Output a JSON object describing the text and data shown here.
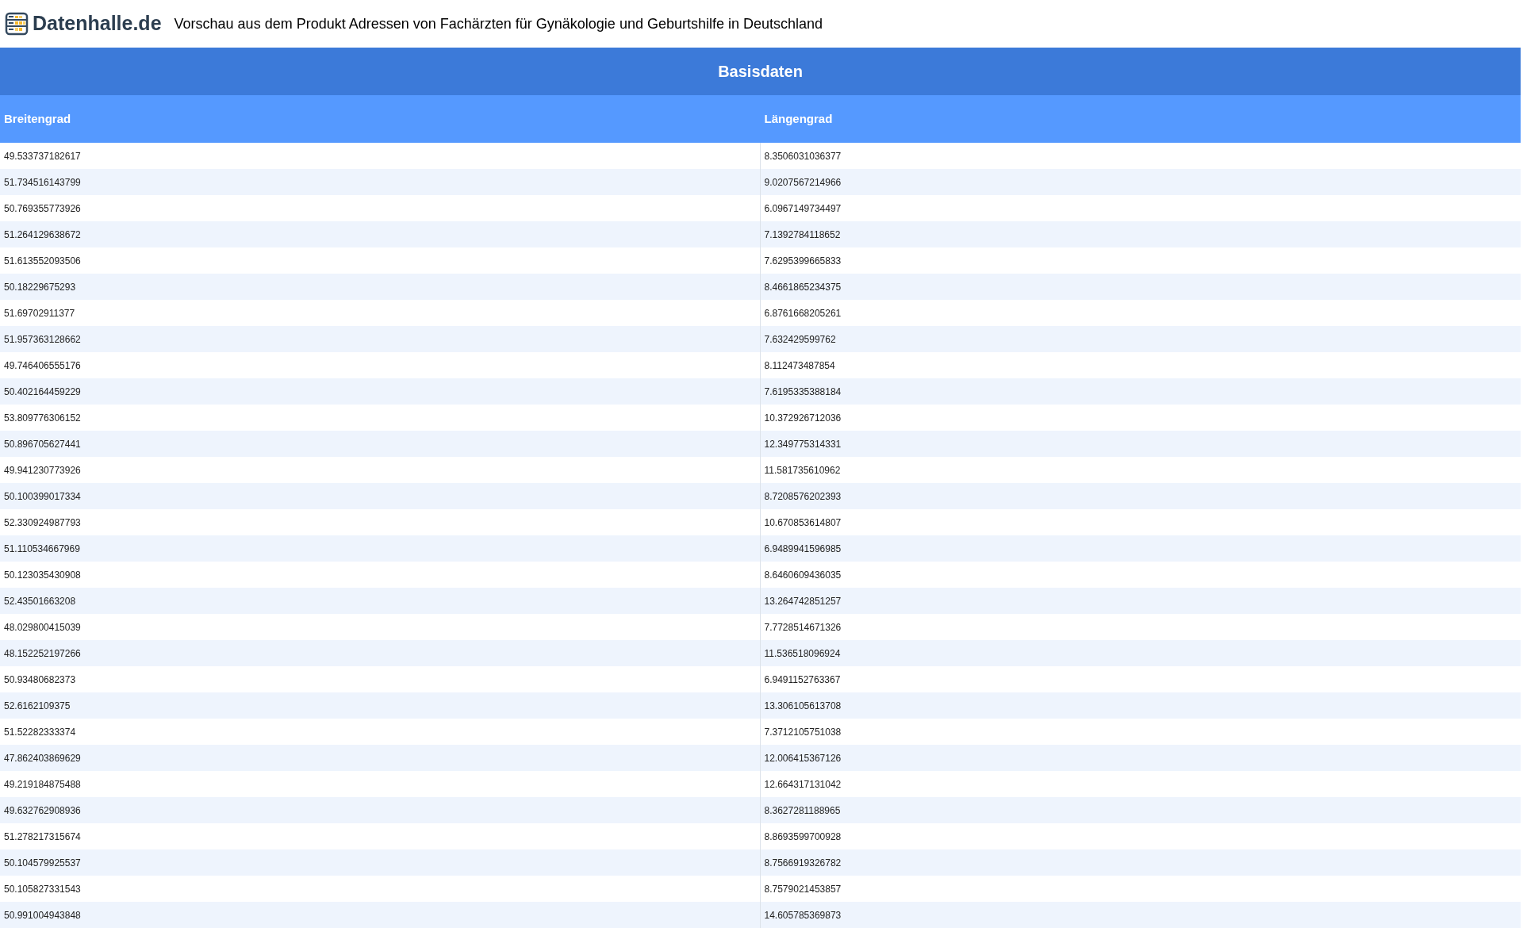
{
  "header": {
    "logo_text": "Datenhalle.de",
    "title": "Vorschau aus dem Produkt Adressen von Fachärzten für Gynäkologie und Geburtshilfe in Deutschland"
  },
  "section_title": "Basisdaten",
  "table": {
    "columns": [
      "Breitengrad",
      "Längengrad"
    ],
    "rows": [
      [
        "49.533737182617",
        "8.3506031036377"
      ],
      [
        "51.734516143799",
        "9.0207567214966"
      ],
      [
        "50.769355773926",
        "6.0967149734497"
      ],
      [
        "51.264129638672",
        "7.1392784118652"
      ],
      [
        "51.613552093506",
        "7.6295399665833"
      ],
      [
        "50.18229675293",
        "8.4661865234375"
      ],
      [
        "51.69702911377",
        "6.8761668205261"
      ],
      [
        "51.957363128662",
        "7.632429599762"
      ],
      [
        "49.746406555176",
        "8.112473487854"
      ],
      [
        "50.402164459229",
        "7.6195335388184"
      ],
      [
        "53.809776306152",
        "10.372926712036"
      ],
      [
        "50.896705627441",
        "12.349775314331"
      ],
      [
        "49.941230773926",
        "11.581735610962"
      ],
      [
        "50.100399017334",
        "8.7208576202393"
      ],
      [
        "52.330924987793",
        "10.670853614807"
      ],
      [
        "51.110534667969",
        "6.9489941596985"
      ],
      [
        "50.123035430908",
        "8.6460609436035"
      ],
      [
        "52.43501663208",
        "13.264742851257"
      ],
      [
        "48.029800415039",
        "7.7728514671326"
      ],
      [
        "48.152252197266",
        "11.536518096924"
      ],
      [
        "50.93480682373",
        "6.9491152763367"
      ],
      [
        "52.6162109375",
        "13.306105613708"
      ],
      [
        "51.52282333374",
        "7.3712105751038"
      ],
      [
        "47.862403869629",
        "12.006415367126"
      ],
      [
        "49.219184875488",
        "12.664317131042"
      ],
      [
        "49.632762908936",
        "8.3627281188965"
      ],
      [
        "51.278217315674",
        "8.8693599700928"
      ],
      [
        "50.104579925537",
        "8.7566919326782"
      ],
      [
        "50.105827331543",
        "8.7579021453857"
      ],
      [
        "50.991004943848",
        "14.605785369873"
      ]
    ]
  }
}
